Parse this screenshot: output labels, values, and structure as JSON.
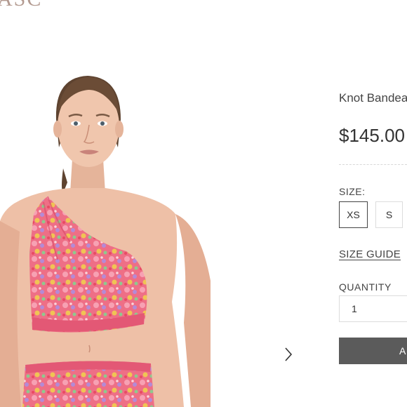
{
  "brand": {
    "logo_text": "ASC"
  },
  "product": {
    "title": "Knot Bandea",
    "price": "$145.00",
    "image_alt": "Model wearing floral one-shoulder knot bandeau bikini top"
  },
  "size": {
    "label": "SIZE:",
    "options": [
      "XS",
      "S"
    ],
    "selected": "XS",
    "guide_label": "SIZE GUIDE"
  },
  "quantity": {
    "label": "QUANTITY",
    "value": "1"
  },
  "cart": {
    "add_label": "A"
  },
  "icons": {
    "gallery_next": "chevron-right-icon"
  },
  "colors": {
    "button_bg": "#5b5b5b",
    "logo": "#b39a90"
  }
}
